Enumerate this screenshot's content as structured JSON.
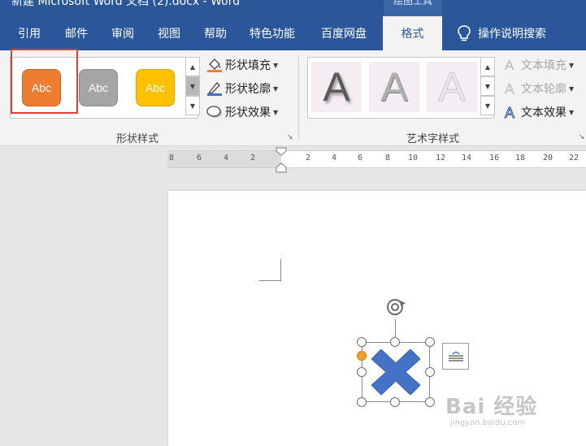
{
  "window": {
    "title": "新建 Microsoft Word 文档 (2).docx  -  Word",
    "context_tab_header": "绘图工具"
  },
  "tabs": [
    {
      "label": "引用"
    },
    {
      "label": "邮件"
    },
    {
      "label": "审阅"
    },
    {
      "label": "视图"
    },
    {
      "label": "帮助"
    },
    {
      "label": "特色功能"
    },
    {
      "label": "百度网盘"
    },
    {
      "label": "格式",
      "active": true
    }
  ],
  "tell_me": {
    "label": "操作说明搜索",
    "icon": "lightbulb-icon"
  },
  "ribbon": {
    "shape_styles": {
      "group_label": "形状样式",
      "gallery": [
        {
          "label": "Abc",
          "color": "#ed7d31",
          "selected": true
        },
        {
          "label": "Abc",
          "color": "#a5a5a5"
        },
        {
          "label": "Abc",
          "color": "#ffc000"
        }
      ],
      "commands": [
        {
          "label": "形状填充",
          "icon": "paint-bucket-icon"
        },
        {
          "label": "形状轮廓",
          "icon": "pencil-outline-icon"
        },
        {
          "label": "形状效果",
          "icon": "shape-effects-icon"
        }
      ]
    },
    "wordart_styles": {
      "group_label": "艺术字样式",
      "gallery": [
        {
          "label": "A",
          "style": "shadow"
        },
        {
          "label": "A",
          "style": "gradient"
        },
        {
          "label": "A",
          "style": "light-outline"
        }
      ],
      "commands": [
        {
          "label": "文本填充",
          "icon": "text-fill-icon",
          "enabled": false
        },
        {
          "label": "文本轮廓",
          "icon": "text-outline-icon",
          "enabled": false
        },
        {
          "label": "文本效果",
          "icon": "text-effects-icon",
          "enabled": true
        }
      ]
    }
  },
  "ruler": {
    "ticks": [
      "8",
      "6",
      "4",
      "2",
      "2",
      "4",
      "6",
      "8",
      "10",
      "12",
      "14",
      "16",
      "18",
      "20",
      "22"
    ]
  },
  "document": {
    "shape": {
      "type": "cross",
      "fill": "#4472c4",
      "selected": true
    }
  },
  "colors": {
    "title_bar": "#2b579a",
    "accent": "#2b579a",
    "selection_frame": "#e23b3b"
  },
  "watermark": {
    "main": "Bai 经验",
    "sub": "jingyan.baidu.com"
  }
}
